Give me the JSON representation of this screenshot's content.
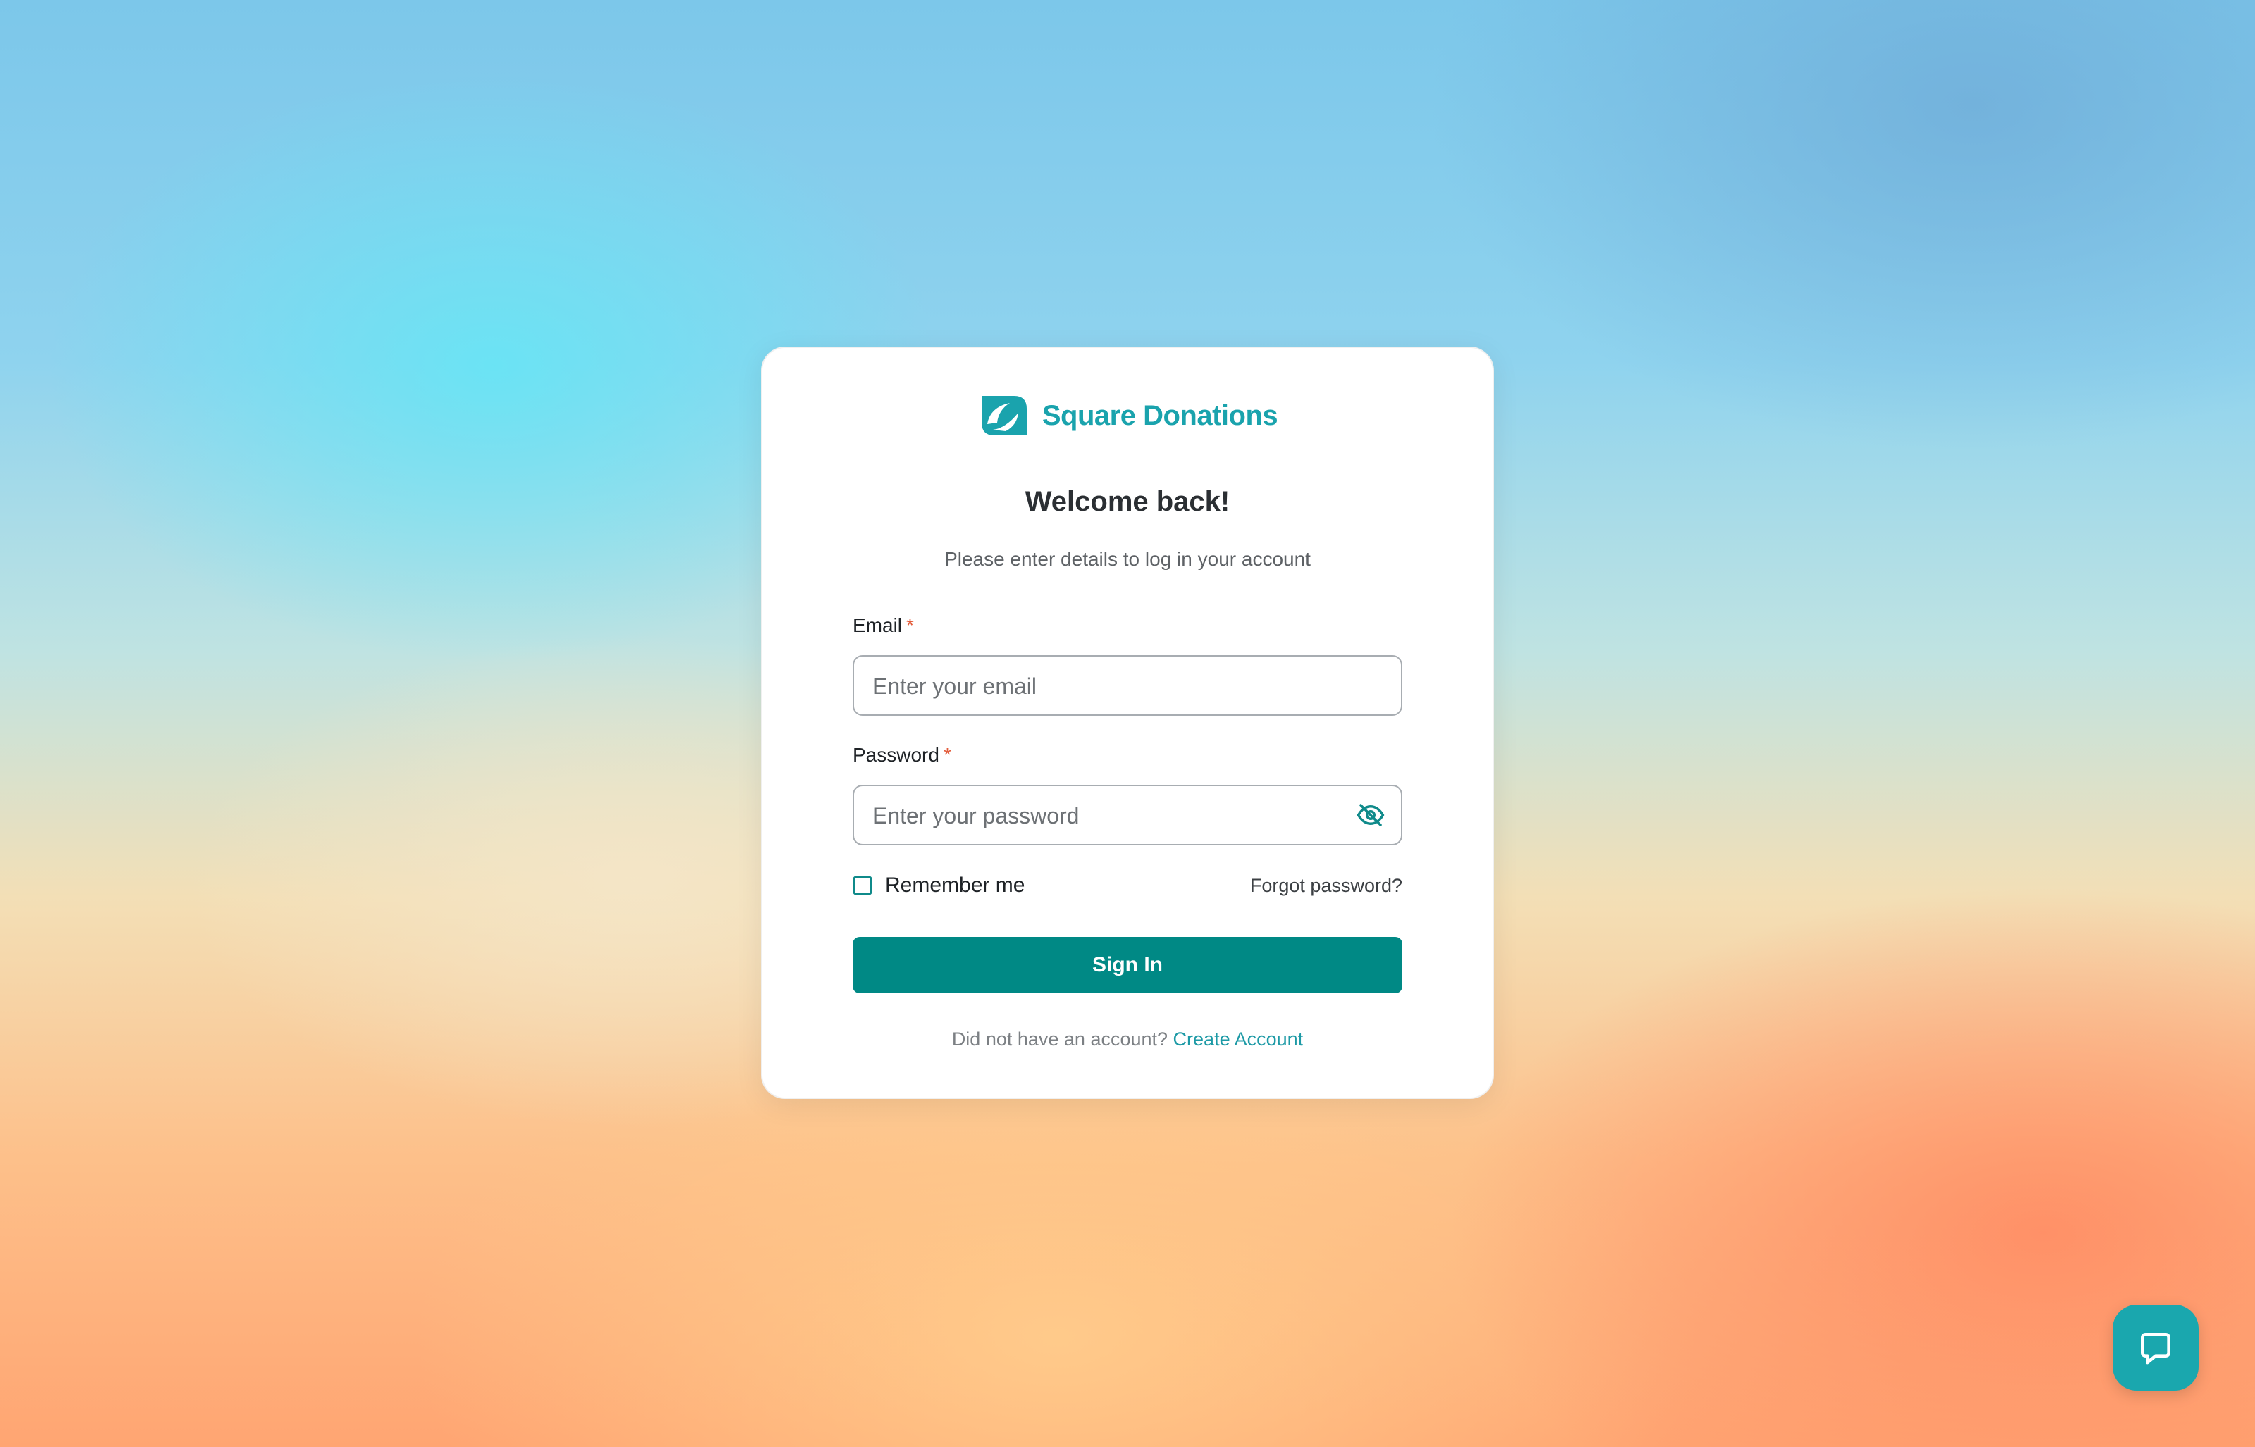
{
  "brand": {
    "name": "Square Donations",
    "logo_icon": "leaf-swirl-logo",
    "accent_color": "#1aa3ad",
    "button_color": "#008985"
  },
  "login": {
    "title": "Welcome back!",
    "subtitle": "Please enter details to log in your account",
    "email": {
      "label": "Email",
      "required_mark": "*",
      "value": "",
      "placeholder": "Enter your email"
    },
    "password": {
      "label": "Password",
      "required_mark": "*",
      "value": "",
      "placeholder": "Enter your password",
      "toggle_icon": "eye-off-icon"
    },
    "remember": {
      "label": "Remember me",
      "checked": false
    },
    "forgot_label": "Forgot password?",
    "submit_label": "Sign In",
    "footer_text": "Did not have an account?",
    "footer_link": "Create Account"
  },
  "help_widget": {
    "icon": "chat-bubble-icon"
  }
}
